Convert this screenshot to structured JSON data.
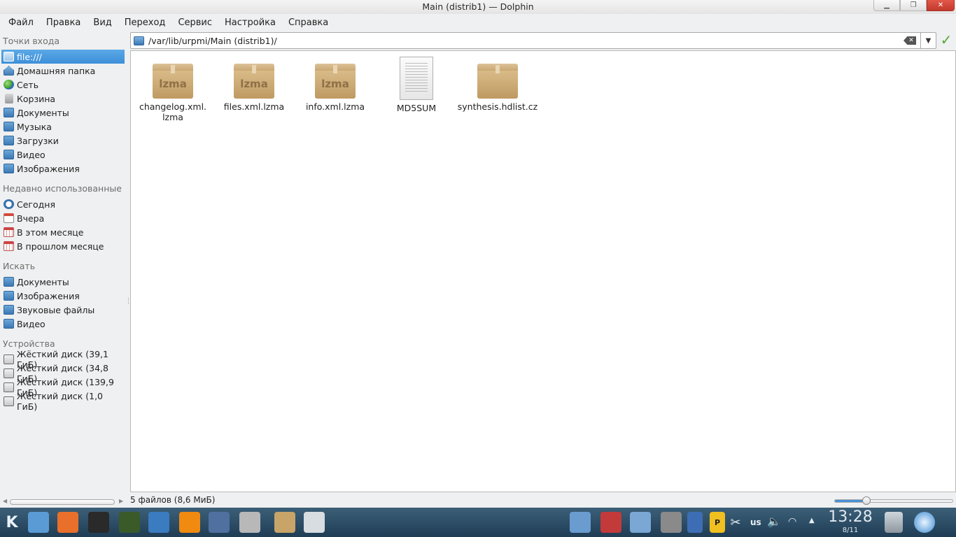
{
  "window": {
    "title": "Main (distrib1) — Dolphin",
    "min_glyph": "▁",
    "max_glyph": "❐",
    "close_glyph": "✕"
  },
  "menu": [
    {
      "label": "Файл"
    },
    {
      "label": "Правка"
    },
    {
      "label": "Вид"
    },
    {
      "label": "Переход"
    },
    {
      "label": "Сервис"
    },
    {
      "label": "Настройка"
    },
    {
      "label": "Справка"
    }
  ],
  "sidebar": {
    "entry_title": "Точки входа",
    "entry_items": [
      {
        "label": "file:///",
        "icon": "folder-icon"
      },
      {
        "label": "Домашняя папка",
        "icon": "home-icon"
      },
      {
        "label": "Сеть",
        "icon": "globe-icon"
      },
      {
        "label": "Корзина",
        "icon": "trash-icon"
      },
      {
        "label": "Документы",
        "icon": "folder-icon"
      },
      {
        "label": "Музыка",
        "icon": "folder-icon"
      },
      {
        "label": "Загрузки",
        "icon": "folder-icon"
      },
      {
        "label": "Видео",
        "icon": "folder-icon"
      },
      {
        "label": "Изображения",
        "icon": "folder-icon"
      }
    ],
    "recent_title": "Недавно использованные",
    "recent_items": [
      {
        "label": "Сегодня",
        "icon": "clock-icon"
      },
      {
        "label": "Вчера",
        "icon": "calendar-icon"
      },
      {
        "label": "В этом месяце",
        "icon": "calendar-icon"
      },
      {
        "label": "В прошлом месяце",
        "icon": "calendar-icon"
      }
    ],
    "search_title": "Искать",
    "search_items": [
      {
        "label": "Документы",
        "icon": "folder-icon"
      },
      {
        "label": "Изображения",
        "icon": "folder-icon"
      },
      {
        "label": "Звуковые файлы",
        "icon": "folder-icon"
      },
      {
        "label": "Видео",
        "icon": "folder-icon"
      }
    ],
    "devices_title": "Устройства",
    "devices_items": [
      {
        "label": "Жёсткий диск (39,1 ГиБ)",
        "icon": "hard-disk-icon"
      },
      {
        "label": "Жёсткий диск (34,8 ГиБ)",
        "icon": "hard-disk-icon"
      },
      {
        "label": "Жёсткий диск (139,9 ГиБ)",
        "icon": "hard-disk-icon"
      },
      {
        "label": "Жёсткий диск (1,0 ГиБ)",
        "icon": "hard-disk-icon"
      }
    ]
  },
  "location": {
    "path": "/var/lib/urpmi/Main (distrib1)/",
    "clear_glyph": "✕",
    "dropdown_glyph": "▼",
    "ok_glyph": "✓"
  },
  "files": [
    {
      "name": "changelog.xml.lzma",
      "line1": "changelog.xml.",
      "line2": "lzma",
      "type": "archive",
      "badge": "lzma"
    },
    {
      "name": "files.xml.lzma",
      "line1": "files.xml.lzma",
      "line2": "",
      "type": "archive",
      "badge": "lzma"
    },
    {
      "name": "info.xml.lzma",
      "line1": "info.xml.lzma",
      "line2": "",
      "type": "archive",
      "badge": "lzma"
    },
    {
      "name": "MD5SUM",
      "line1": "MD5SUM",
      "line2": "",
      "type": "text",
      "badge": ""
    },
    {
      "name": "synthesis.hdlist.cz",
      "line1": "synthesis.hdlist.cz",
      "line2": "",
      "type": "archive",
      "badge": ""
    }
  ],
  "status": {
    "text": "5 файлов (8,6 МиБ)",
    "zoom_fraction": 0.27
  },
  "taskbar": {
    "kmenu_glyph": "K",
    "keyboard_layout": "us",
    "clock": "13:28",
    "date": "8/11",
    "apps": [
      {
        "icon": "file-manager-icon",
        "color": "#5a9bd6"
      },
      {
        "icon": "firefox-icon",
        "color": "#e8702a"
      },
      {
        "icon": "terminal-icon",
        "color": "#2a2a2a"
      },
      {
        "icon": "system-monitor-icon",
        "color": "#3a5a2a"
      },
      {
        "icon": "ksysguard-icon",
        "color": "#3b7bc0"
      },
      {
        "icon": "vlc-icon",
        "color": "#f08a10"
      },
      {
        "icon": "network-icon",
        "color": "#5070a0"
      },
      {
        "icon": "disc-burner-icon",
        "color": "#b8b8b8"
      },
      {
        "icon": "package-installer-icon",
        "color": "#c8a468"
      },
      {
        "icon": "code-editor-icon",
        "color": "#d8dde2"
      }
    ],
    "tray": [
      {
        "icon": "screenshot-icon",
        "color": "#6a9ccf"
      },
      {
        "icon": "toolbox-icon",
        "color": "#c33a3a"
      },
      {
        "icon": "windows-icon",
        "color": "#7aa7d3"
      },
      {
        "icon": "settings-panel-icon",
        "color": "#8a8a8a"
      },
      {
        "icon": "puzzle-icon",
        "color": "#3d6eb5"
      },
      {
        "icon": "p-icon",
        "color": "#f0c020"
      },
      {
        "icon": "scissors-icon",
        "color": "transparent"
      }
    ]
  }
}
